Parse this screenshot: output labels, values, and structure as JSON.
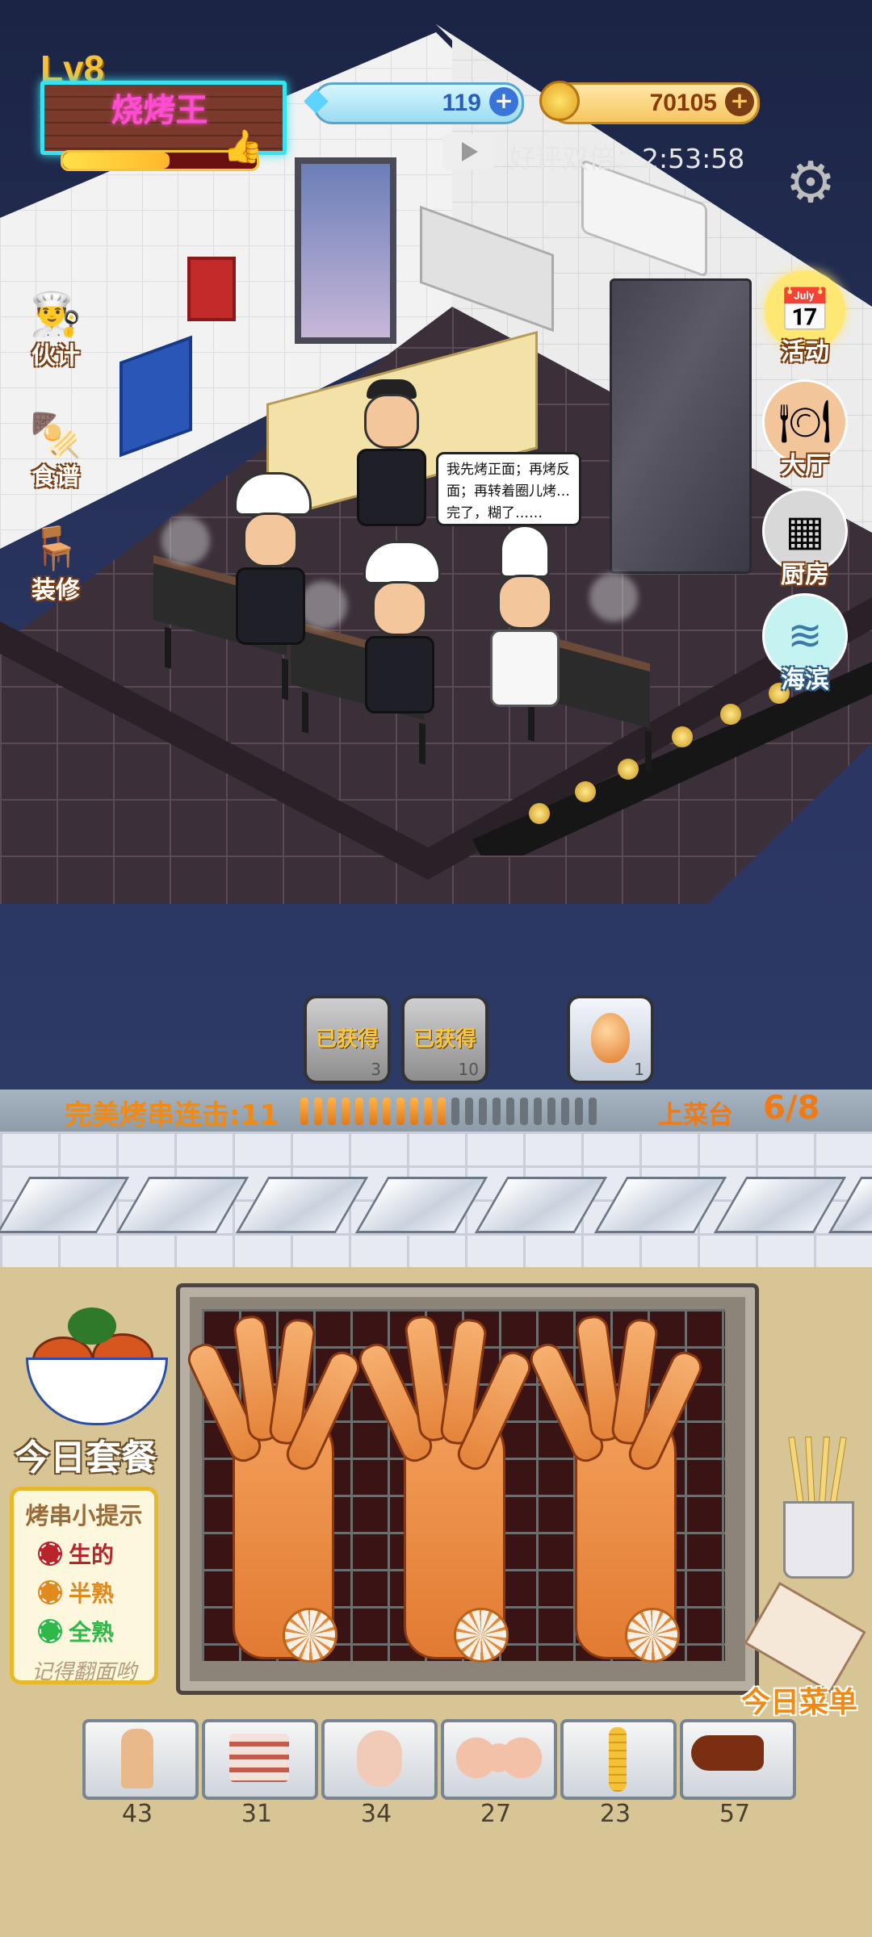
{
  "hud": {
    "level": "Lv8",
    "shop_sign": "烧烤王",
    "xp_fraction": 0.55,
    "gems": "119",
    "coins": "70105",
    "ad_bonus_label": "好评双倍：2:53:58"
  },
  "left_menu": [
    {
      "label": "伙计",
      "icon": "chef-icon"
    },
    {
      "label": "食谱",
      "icon": "skewer-icon"
    },
    {
      "label": "装修",
      "icon": "table-icon"
    }
  ],
  "right_menu": [
    {
      "label": "活动",
      "icon": "calendar-icon"
    },
    {
      "label": "大厅",
      "icon": "dining-hall-icon"
    },
    {
      "label": "厨房",
      "icon": "kitchen-icon"
    },
    {
      "label": "海滨",
      "icon": "seaside-icon"
    }
  ],
  "speech_bubble": "我先烤正面；再烤反面；再转着圈儿烤…完了，糊了……",
  "rewards": [
    {
      "label": "已获得",
      "count": "3"
    },
    {
      "label": "已获得",
      "count": "10"
    },
    {
      "label": "",
      "count": "1",
      "icon": "egg-icon"
    }
  ],
  "combo": {
    "label": "完美烤串连击:11",
    "filled": 11,
    "total": 22,
    "serve_label": "上菜台",
    "serve_count": "6/8"
  },
  "daily_meal_label": "今日套餐",
  "tips": {
    "title": "烤串小提示",
    "raw": "生的",
    "half": "半熟",
    "done": "全熟",
    "note": "记得翻面哟",
    "colors": {
      "raw": "#b8242a",
      "half": "#e08a1e",
      "done": "#2fb84a"
    }
  },
  "menu_label": "今日菜单",
  "ingredients": [
    {
      "name": "chicken-feet",
      "count": "43"
    },
    {
      "name": "pork-belly",
      "count": "31"
    },
    {
      "name": "chicken-wing",
      "count": "34"
    },
    {
      "name": "chicken-breast",
      "count": "27"
    },
    {
      "name": "corn-skewer",
      "count": "23"
    },
    {
      "name": "lamb-leg",
      "count": "57"
    }
  ],
  "colors": {
    "accent_orange": "#f08a13",
    "neon_cyan": "#39e2ef",
    "neon_pink": "#ff4dd2"
  }
}
